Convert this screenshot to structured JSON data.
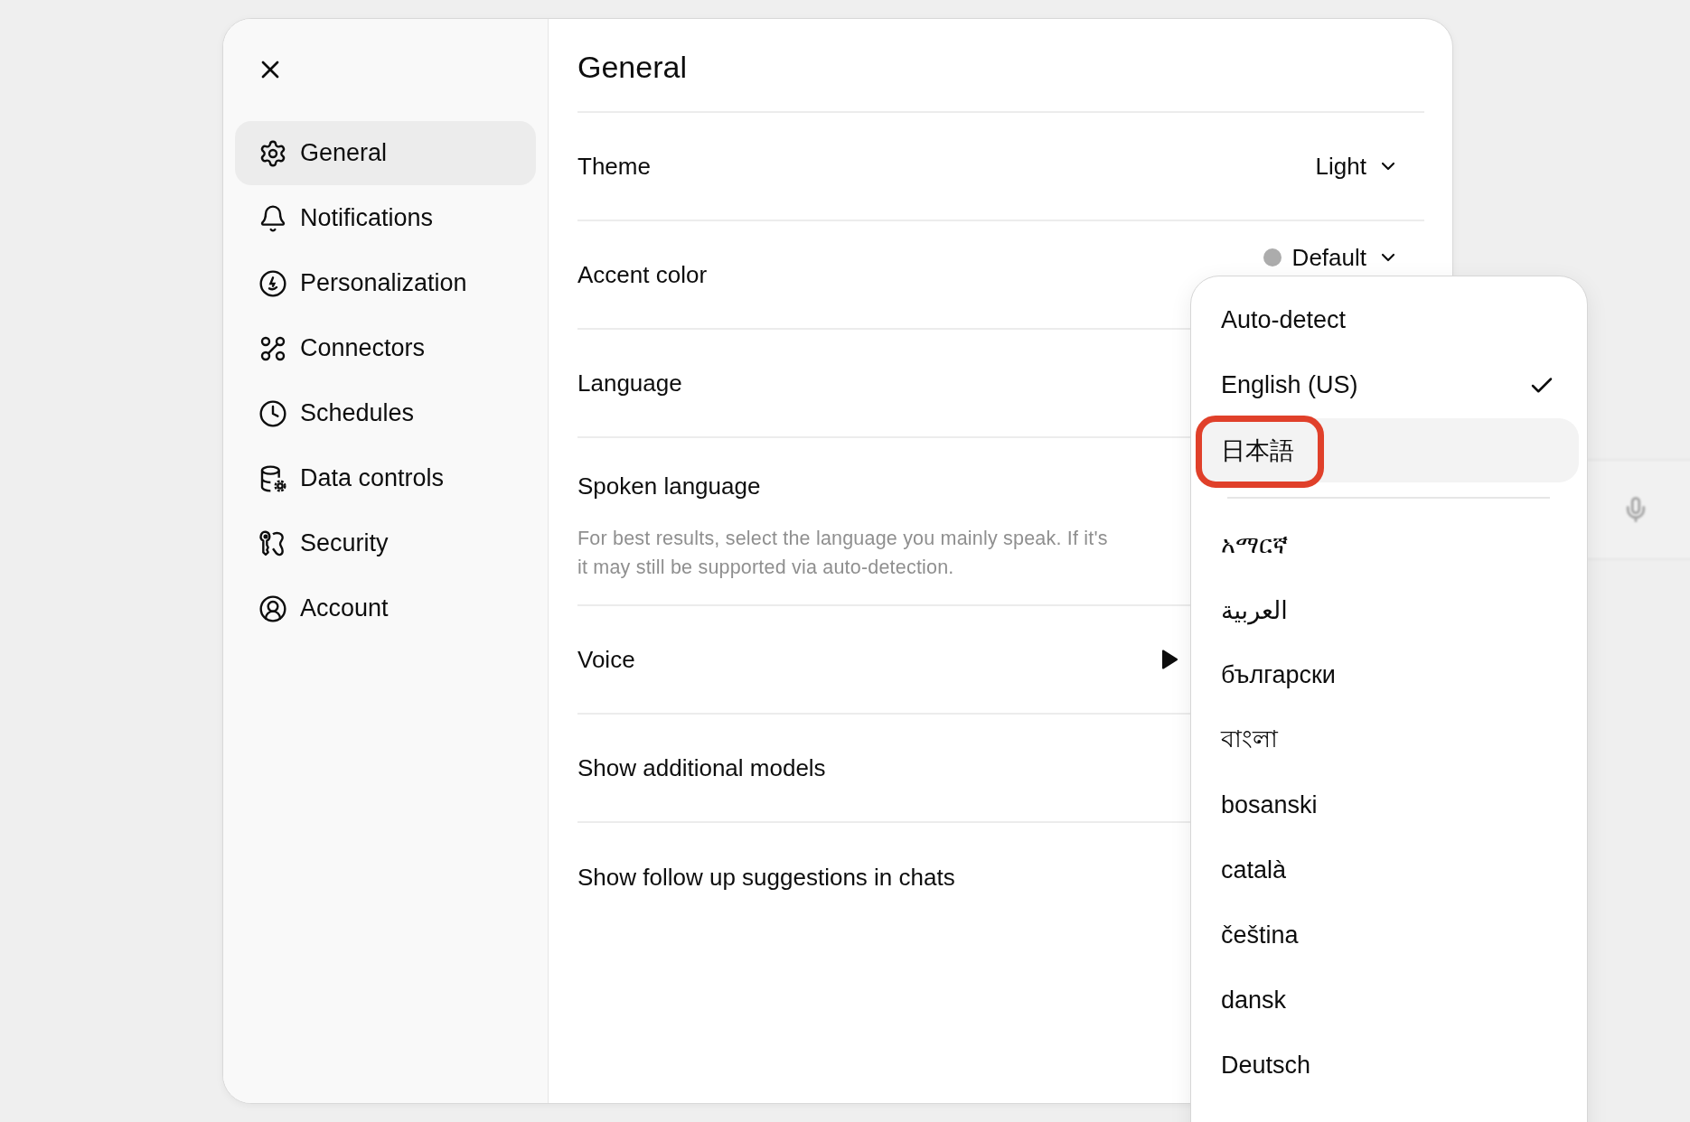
{
  "sidebar": {
    "items": [
      {
        "label": "General",
        "selected": true
      },
      {
        "label": "Notifications",
        "selected": false
      },
      {
        "label": "Personalization",
        "selected": false
      },
      {
        "label": "Connectors",
        "selected": false
      },
      {
        "label": "Schedules",
        "selected": false
      },
      {
        "label": "Data controls",
        "selected": false
      },
      {
        "label": "Security",
        "selected": false
      },
      {
        "label": "Account",
        "selected": false
      }
    ]
  },
  "main": {
    "title": "General",
    "rows": [
      {
        "kind": "select",
        "label": "Theme",
        "value": "Light"
      },
      {
        "kind": "color",
        "label": "Accent color",
        "value": "Default"
      },
      {
        "kind": "plain",
        "label": "Language"
      },
      {
        "kind": "description",
        "label": "Spoken language",
        "description_lines": [
          "For best results, select the language you mainly speak. If it's",
          "it may still be supported via auto-detection."
        ]
      },
      {
        "kind": "voice",
        "label": "Voice"
      },
      {
        "kind": "plain",
        "label": "Show additional models"
      },
      {
        "kind": "plain",
        "label": "Show follow up suggestions in chats"
      }
    ]
  },
  "language_menu": {
    "items": [
      {
        "label": "Auto-detect",
        "selected": false,
        "hovered": false,
        "annotated": false
      },
      {
        "label": "English (US)",
        "selected": true,
        "hovered": false,
        "annotated": false
      },
      {
        "label": "日本語",
        "selected": false,
        "hovered": true,
        "annotated": true,
        "divider_after": true
      },
      {
        "label": "አማርኛ",
        "selected": false,
        "hovered": false,
        "annotated": false
      },
      {
        "label": "العربية",
        "selected": false,
        "hovered": false,
        "annotated": false
      },
      {
        "label": "български",
        "selected": false,
        "hovered": false,
        "annotated": false
      },
      {
        "label": "বাংলা",
        "selected": false,
        "hovered": false,
        "annotated": false
      },
      {
        "label": "bosanski",
        "selected": false,
        "hovered": false,
        "annotated": false
      },
      {
        "label": "català",
        "selected": false,
        "hovered": false,
        "annotated": false
      },
      {
        "label": "čeština",
        "selected": false,
        "hovered": false,
        "annotated": false
      },
      {
        "label": "dansk",
        "selected": false,
        "hovered": false,
        "annotated": false
      },
      {
        "label": "Deutsch",
        "selected": false,
        "hovered": false,
        "annotated": false
      }
    ]
  }
}
